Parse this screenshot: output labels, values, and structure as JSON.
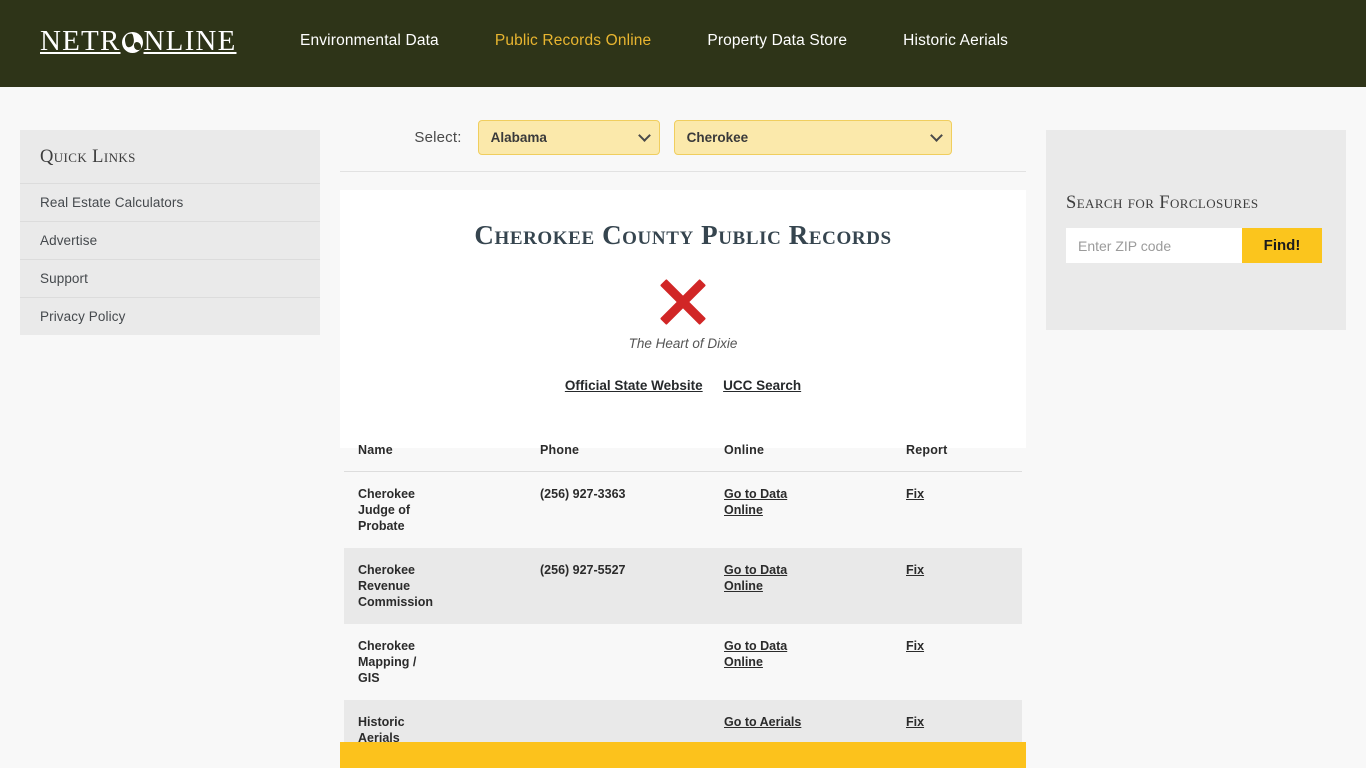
{
  "header": {
    "logo": {
      "prefix": "NETR",
      "icon": "globe-icon",
      "suffix": "NLINE"
    },
    "nav": [
      {
        "label": "Environmental Data",
        "active": false
      },
      {
        "label": "Public Records Online",
        "active": true
      },
      {
        "label": "Property Data Store",
        "active": false
      },
      {
        "label": "Historic Aerials",
        "active": false
      }
    ],
    "bg_color": "#2e3418",
    "active_color": "#e8b530"
  },
  "quick_links": {
    "title": "Quick Links",
    "items": [
      {
        "label": "Real Estate Calculators"
      },
      {
        "label": "Advertise"
      },
      {
        "label": "Support"
      },
      {
        "label": "Privacy Policy"
      }
    ]
  },
  "selector": {
    "label": "Select:",
    "state": {
      "value": "Alabama"
    },
    "county": {
      "value": "Cherokee"
    }
  },
  "panel": {
    "title": "Cherokee County Public Records",
    "seal_alt": "The Heart of Dixie",
    "seal_icon": "broken-image-x-icon",
    "links": [
      {
        "label": "Official State Website"
      },
      {
        "label": "UCC Search"
      }
    ]
  },
  "table": {
    "columns": [
      "Name",
      "Phone",
      "Online",
      "Report"
    ],
    "rows": [
      {
        "name": "Cherokee Judge of Probate",
        "phone": "(256) 927-3363",
        "online": "Go to Data Online",
        "report": "Fix"
      },
      {
        "name": "Cherokee Revenue Commission",
        "phone": "(256) 927-5527",
        "online": "Go to Data Online",
        "report": "Fix"
      },
      {
        "name": "Cherokee Mapping / GIS",
        "phone": "",
        "online": "Go to Data Online",
        "report": "Fix"
      },
      {
        "name": "Historic Aerials",
        "phone": "",
        "online": "Go to Aerials",
        "report": "Fix"
      }
    ]
  },
  "foreclosures": {
    "title": "Search for Forclosures",
    "zip_placeholder": "Enter ZIP code",
    "zip_value": "",
    "button_label": "Find!",
    "button_color": "#fbc51d"
  },
  "footer_bar": {
    "color": "#fcc21c"
  }
}
